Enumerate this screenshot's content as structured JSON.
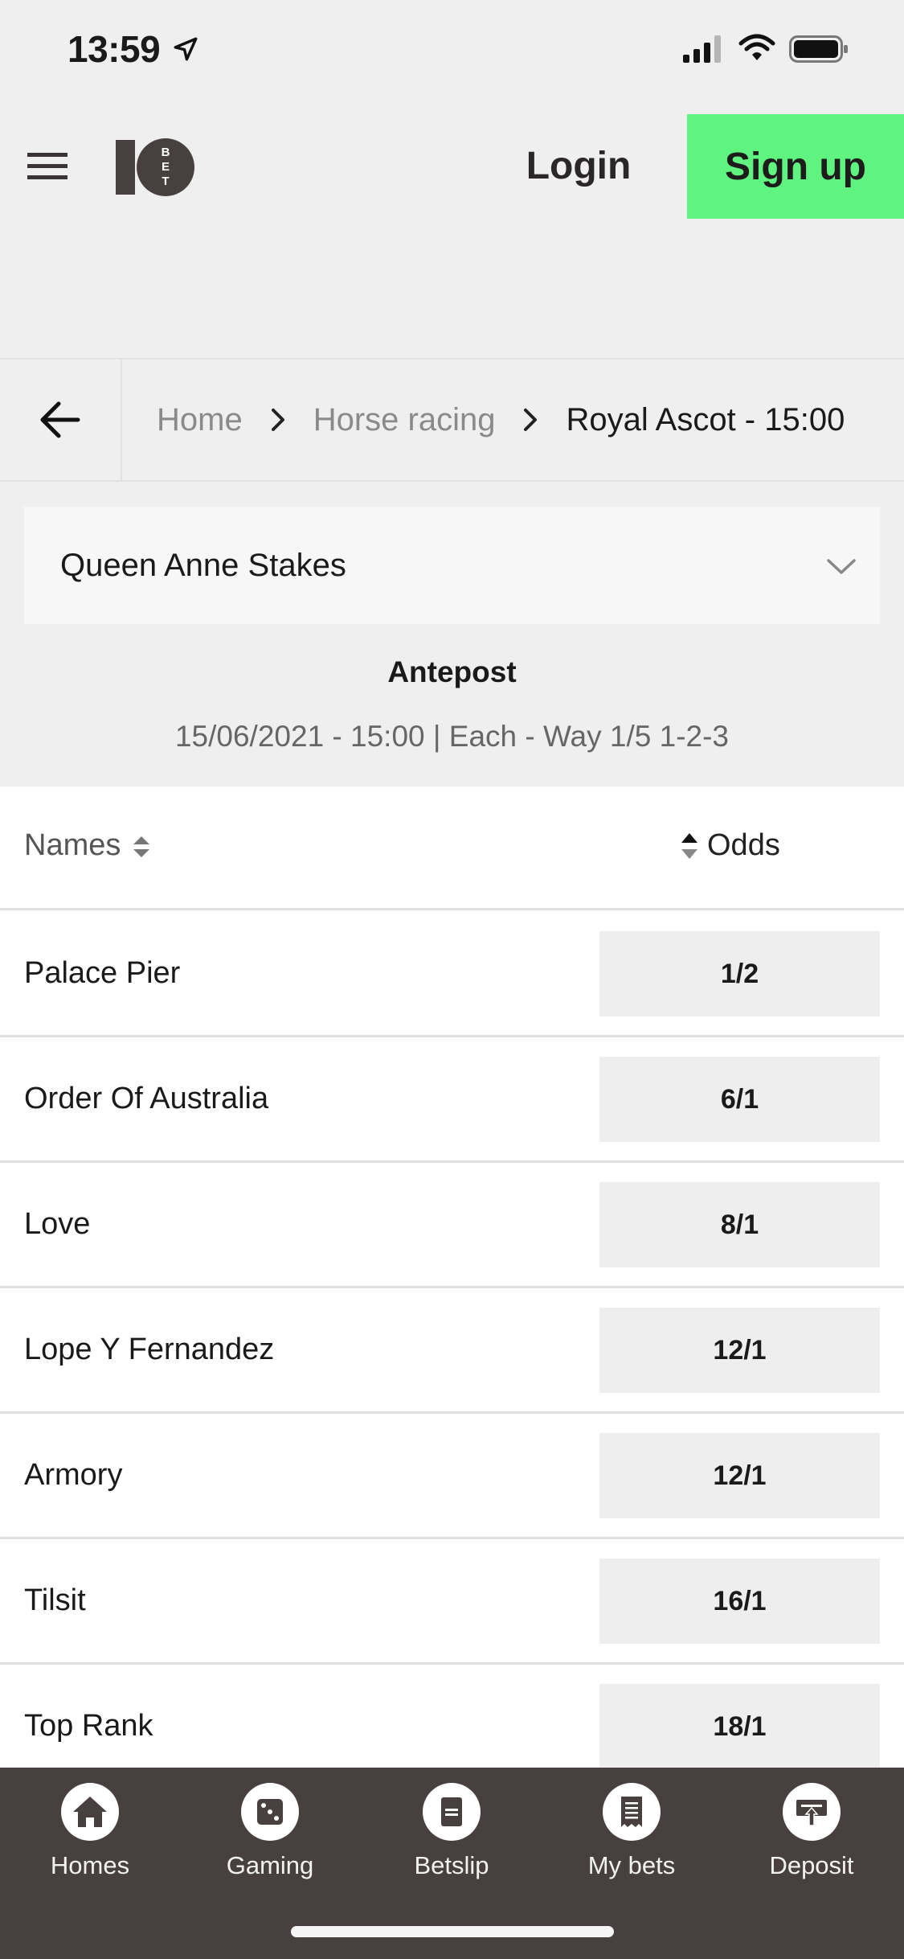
{
  "status_bar": {
    "time": "13:59",
    "icons": [
      "location-arrow-icon",
      "cellular-signal-icon",
      "wifi-icon",
      "battery-icon"
    ]
  },
  "header": {
    "menu_icon": "hamburger-menu-icon",
    "logo_text": "10BET",
    "login_label": "Login",
    "signup_label": "Sign up",
    "colors": {
      "signup_bg": "#5ff47f",
      "text_dark": "#2b2627"
    }
  },
  "breadcrumb": {
    "back_icon": "arrow-left-icon",
    "items": [
      "Home",
      "Horse racing",
      "Royal Ascot - 15:00"
    ]
  },
  "event_selector": {
    "selected": "Queen Anne Stakes"
  },
  "market": {
    "title": "Antepost",
    "subtitle": "15/06/2021 - 15:00 | Each - Way 1/5 1-2-3"
  },
  "table": {
    "col_names": "Names",
    "col_odds": "Odds",
    "rows": [
      {
        "name": "Palace Pier",
        "odds": "1/2"
      },
      {
        "name": "Order Of Australia",
        "odds": "6/1"
      },
      {
        "name": "Love",
        "odds": "8/1"
      },
      {
        "name": "Lope Y Fernandez",
        "odds": "12/1"
      },
      {
        "name": "Armory",
        "odds": "12/1"
      },
      {
        "name": "Tilsit",
        "odds": "16/1"
      },
      {
        "name": "Top Rank",
        "odds": "18/1"
      }
    ]
  },
  "bottom_nav": {
    "items": [
      {
        "label": "Homes",
        "icon": "home-icon"
      },
      {
        "label": "Gaming",
        "icon": "dice-icon"
      },
      {
        "label": "Betslip",
        "icon": "betslip-icon"
      },
      {
        "label": "My bets",
        "icon": "receipt-icon"
      },
      {
        "label": "Deposit",
        "icon": "deposit-icon"
      }
    ],
    "colors": {
      "background": "#48403f"
    }
  }
}
